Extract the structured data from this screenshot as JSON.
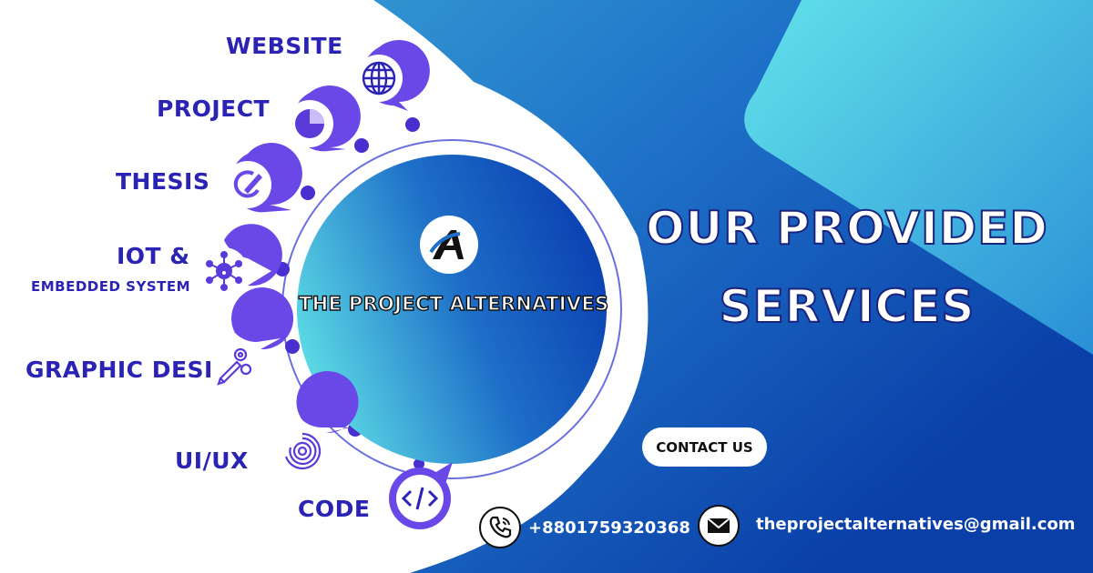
{
  "headline": {
    "line1": "OUR PROVIDED",
    "line2": "SERVICES"
  },
  "brand": {
    "name": "THE PROJECT ALTERNATIVES",
    "logo_letter": "A"
  },
  "services": [
    {
      "label": "WEBSITE",
      "icon": "globe-icon"
    },
    {
      "label": "PROJECT",
      "icon": "pie-chart-icon"
    },
    {
      "label": "THESIS",
      "icon": "pencil-icon"
    },
    {
      "label": "IOT &",
      "sublabel": "EMBEDDED SYSTEM",
      "icon": "network-icon"
    },
    {
      "label": "GRAPHIC DESIGN",
      "icon": "design-tools-icon"
    },
    {
      "label": "UI/UX",
      "icon": "fingerprint-icon"
    },
    {
      "label": "CODE",
      "icon": "code-icon"
    }
  ],
  "contact": {
    "button": "CONTACT US",
    "phone": "+8801759320368",
    "email": "theprojectalternatives@gmail.com",
    "phone_icon": "phone-icon",
    "email_icon": "envelope-icon"
  },
  "colors": {
    "accent_purple": "#6a48e8",
    "label_blue": "#2a23b4",
    "bg_light": "#3fb0d8",
    "bg_dark": "#0a47b0"
  }
}
